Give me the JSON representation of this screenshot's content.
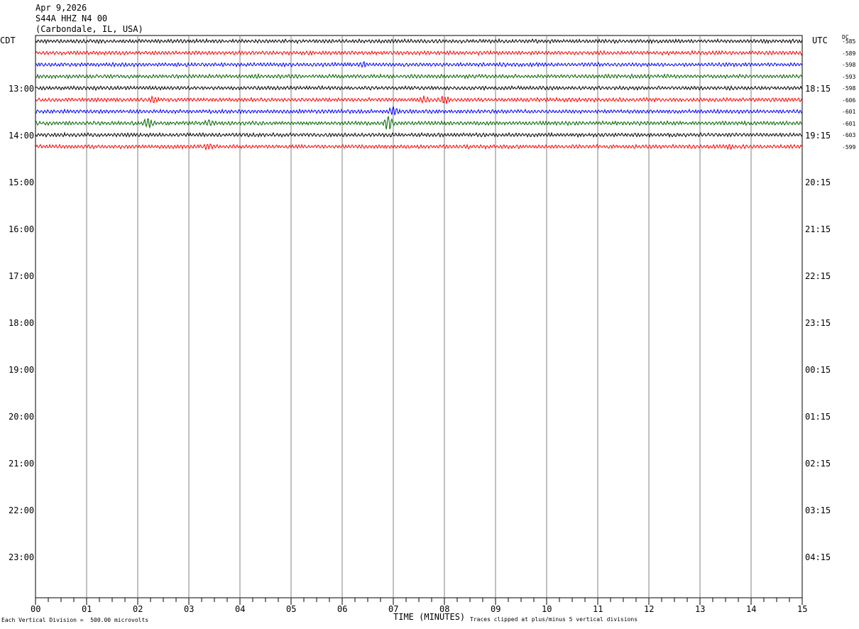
{
  "header": {
    "date": "Apr 9,2026",
    "station": "S44A HHZ N4 00",
    "location": "(Carbondale, IL, USA)"
  },
  "left_zone": "CDT",
  "right_zone": "UTC",
  "dc_label": "DC",
  "footer": {
    "scale_note": "Each Vertical Division =  500.00 microvolts",
    "xlabel": "TIME (MINUTES)",
    "clip_note": "Traces clipped at plus/minus 5 vertical divisions"
  },
  "colors": [
    "#000000",
    "#ff0000",
    "#0000ff",
    "#006400"
  ],
  "chart_data": {
    "type": "line",
    "title": "S44A HHZ N4 00",
    "xlabel": "TIME (MINUTES)",
    "xlim": [
      0,
      15
    ],
    "x_ticks": [
      "00",
      "01",
      "02",
      "03",
      "04",
      "05",
      "06",
      "07",
      "08",
      "09",
      "10",
      "11",
      "12",
      "13",
      "14",
      "15"
    ],
    "left_hour_labels": [
      "13:00",
      "14:00",
      "15:00",
      "16:00",
      "17:00",
      "18:00",
      "19:00",
      "20:00",
      "21:00",
      "22:00",
      "23:00"
    ],
    "right_hour_labels": [
      "18:15",
      "19:15",
      "20:15",
      "21:15",
      "22:15",
      "23:15",
      "00:15",
      "01:15",
      "02:15",
      "03:15",
      "04:15"
    ],
    "dc_offsets": [
      "585",
      "589",
      "598",
      "593",
      "598",
      "606",
      "601",
      "601",
      "603",
      "599"
    ],
    "grid": true,
    "traces": [
      {
        "color": "#000000",
        "events": []
      },
      {
        "color": "#ff0000",
        "events": []
      },
      {
        "color": "#0000ff",
        "events": [
          {
            "minute": 6.4,
            "amp": 2
          }
        ]
      },
      {
        "color": "#006400",
        "events": [
          {
            "minute": 4.3,
            "amp": 2
          }
        ]
      },
      {
        "color": "#000000",
        "events": []
      },
      {
        "color": "#ff0000",
        "events": [
          {
            "minute": 2.3,
            "amp": 3
          },
          {
            "minute": 7.6,
            "amp": 3
          },
          {
            "minute": 8.0,
            "amp": 4
          }
        ]
      },
      {
        "color": "#0000ff",
        "events": [
          {
            "minute": 7.0,
            "amp": 5
          }
        ]
      },
      {
        "color": "#006400",
        "events": [
          {
            "minute": 2.2,
            "amp": 6
          },
          {
            "minute": 3.4,
            "amp": 3
          },
          {
            "minute": 6.9,
            "amp": 9
          }
        ]
      },
      {
        "color": "#000000",
        "events": []
      },
      {
        "color": "#ff0000",
        "events": [
          {
            "minute": 3.4,
            "amp": 3
          },
          {
            "minute": 13.6,
            "amp": 2
          }
        ]
      }
    ]
  }
}
